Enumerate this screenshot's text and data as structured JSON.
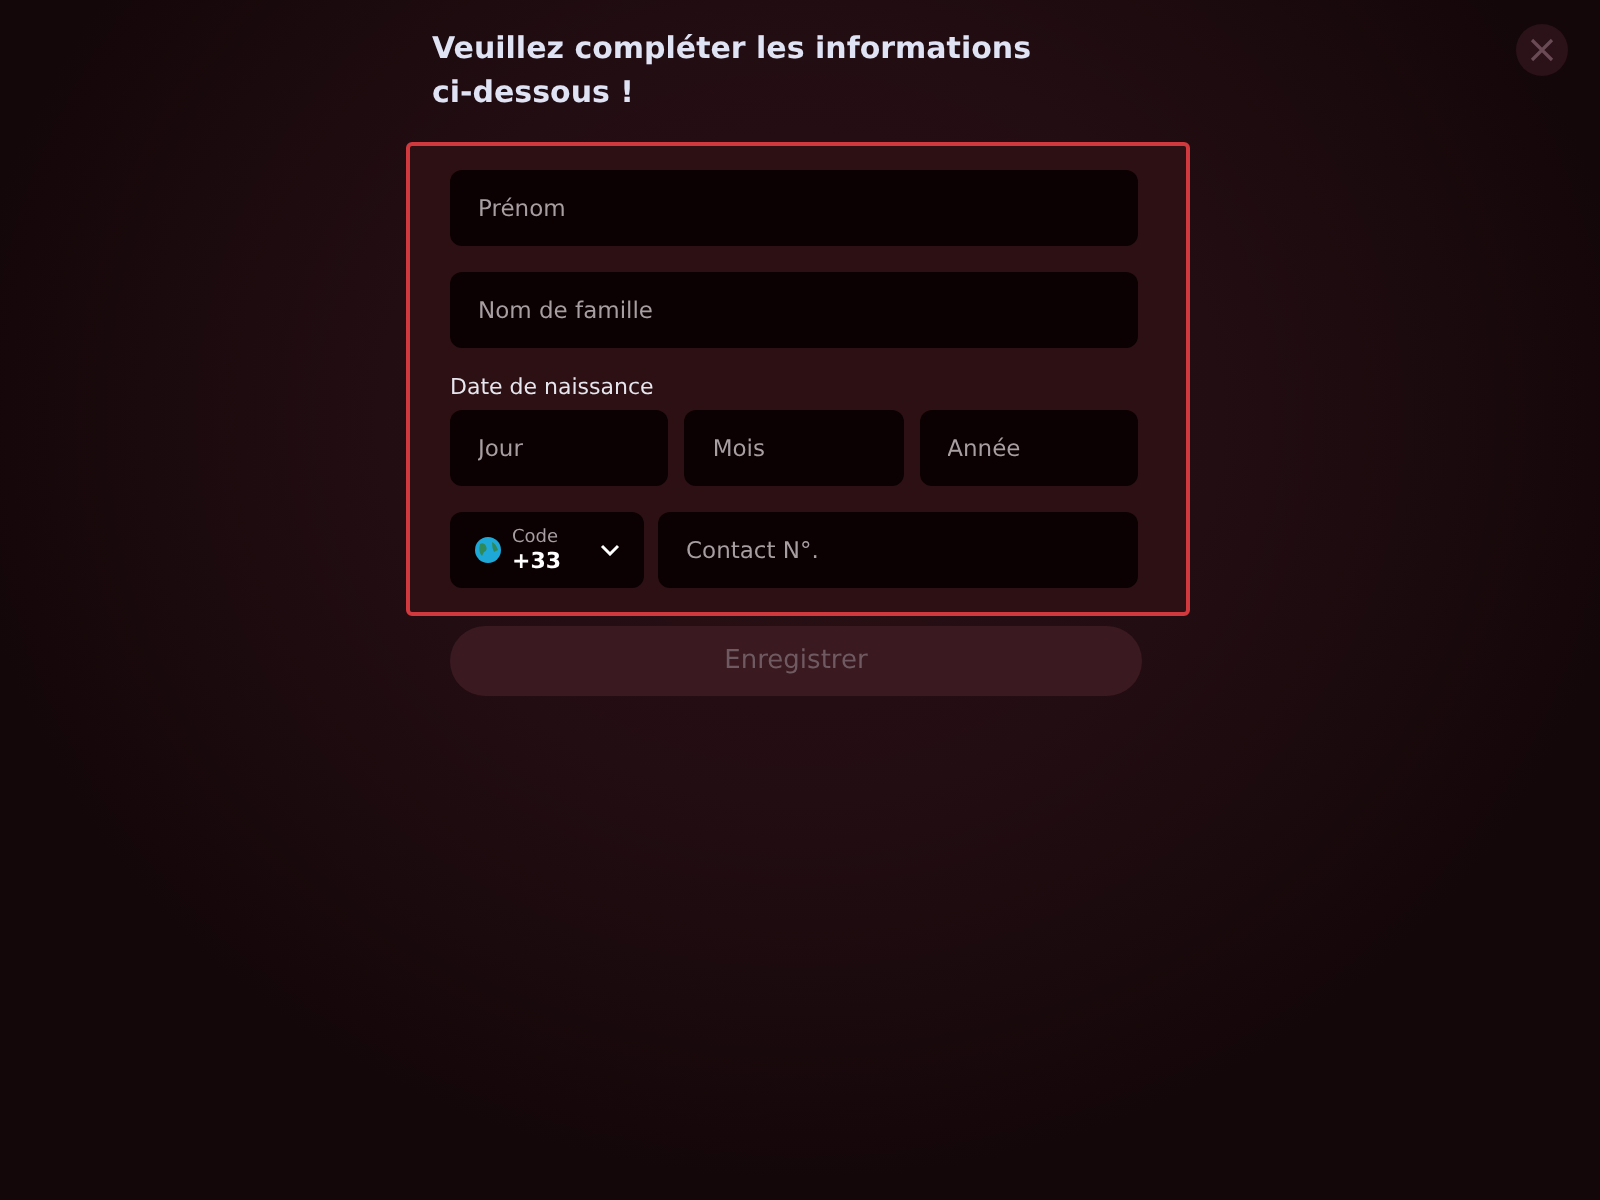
{
  "title": "Veuillez compléter les informations ci-dessous !",
  "fields": {
    "first_name": {
      "placeholder": "Prénom"
    },
    "last_name": {
      "placeholder": "Nom de famille"
    }
  },
  "birth_date": {
    "label": "Date de naissance",
    "fields": [
      {
        "placeholder": "Jour"
      },
      {
        "placeholder": "Mois"
      },
      {
        "placeholder": "Année"
      }
    ]
  },
  "phone": {
    "code_label": "Code",
    "code_value": "+33",
    "placeholder": "Contact N°."
  },
  "submit": {
    "label": "Enregistrer",
    "disabled": true
  }
}
